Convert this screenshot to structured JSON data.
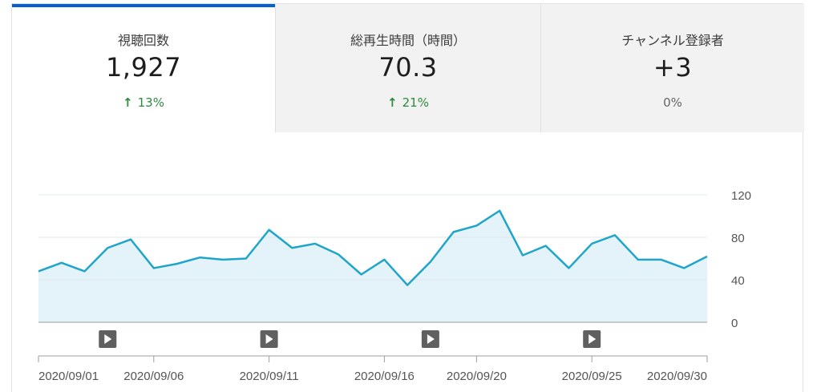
{
  "tabs": [
    {
      "label": "視聴回数",
      "value": "1,927",
      "delta": "13%",
      "direction": "up",
      "active": true
    },
    {
      "label": "総再生時間（時間）",
      "value": "70.3",
      "delta": "21%",
      "direction": "up",
      "active": false
    },
    {
      "label": "チャンネル登録者",
      "value": "+3",
      "delta": "0%",
      "direction": "none",
      "active": false
    }
  ],
  "colors": {
    "accent": "#065fd4",
    "line": "#1fa5c9",
    "area": "#e3f3f9",
    "up": "#2b8a3e"
  },
  "chart_data": {
    "type": "area",
    "x_start": "2020/09/01",
    "x": [
      "2020/09/01",
      "2020/09/02",
      "2020/09/03",
      "2020/09/04",
      "2020/09/05",
      "2020/09/06",
      "2020/09/07",
      "2020/09/08",
      "2020/09/09",
      "2020/09/10",
      "2020/09/11",
      "2020/09/12",
      "2020/09/13",
      "2020/09/14",
      "2020/09/15",
      "2020/09/16",
      "2020/09/17",
      "2020/09/18",
      "2020/09/19",
      "2020/09/20",
      "2020/09/21",
      "2020/09/22",
      "2020/09/23",
      "2020/09/24",
      "2020/09/25",
      "2020/09/26",
      "2020/09/27",
      "2020/09/28",
      "2020/09/29",
      "2020/09/30"
    ],
    "values": [
      48,
      56,
      48,
      70,
      78,
      51,
      55,
      61,
      59,
      60,
      87,
      70,
      74,
      64,
      45,
      59,
      35,
      57,
      85,
      91,
      105,
      63,
      72,
      51,
      74,
      82,
      59,
      59,
      51,
      62
    ],
    "ylim": [
      0,
      120
    ],
    "yticks": [
      0,
      40,
      80,
      120
    ],
    "xtick_labels": [
      "2020/09/01",
      "2020/09/06",
      "2020/09/11",
      "2020/09/16",
      "2020/09/20",
      "2020/09/25",
      "2020/09/30"
    ],
    "xtick_indices": [
      0,
      5,
      10,
      15,
      19,
      24,
      29
    ],
    "video_markers": [
      3,
      10,
      17,
      24
    ],
    "grid": true,
    "title": "",
    "xlabel": "",
    "ylabel": ""
  }
}
